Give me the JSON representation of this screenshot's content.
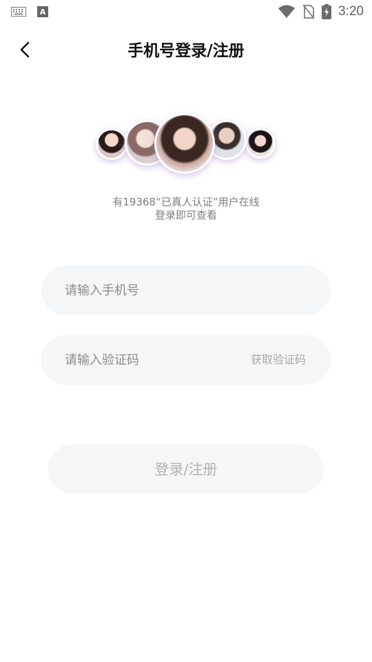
{
  "status_bar": {
    "time": "3:20",
    "icons": [
      "keyboard-icon",
      "a-input-icon",
      "wifi-icon",
      "no-sim-icon",
      "battery-charging-icon"
    ]
  },
  "header": {
    "title": "手机号登录/注册",
    "back_icon": "chevron-left-icon"
  },
  "promo": {
    "line1": "有19368“已真人认证”用户在线",
    "line2": "登录即可查看"
  },
  "form": {
    "phone_placeholder": "请输入手机号",
    "code_placeholder": "请输入验证码",
    "get_code_label": "获取验证码",
    "submit_label": "登录/注册"
  },
  "colors": {
    "field_bg": "#f5f6f8",
    "placeholder": "#8c8c8c",
    "button_text_disabled": "#b1b1b1",
    "avatar_shadow": "#a082d2"
  }
}
